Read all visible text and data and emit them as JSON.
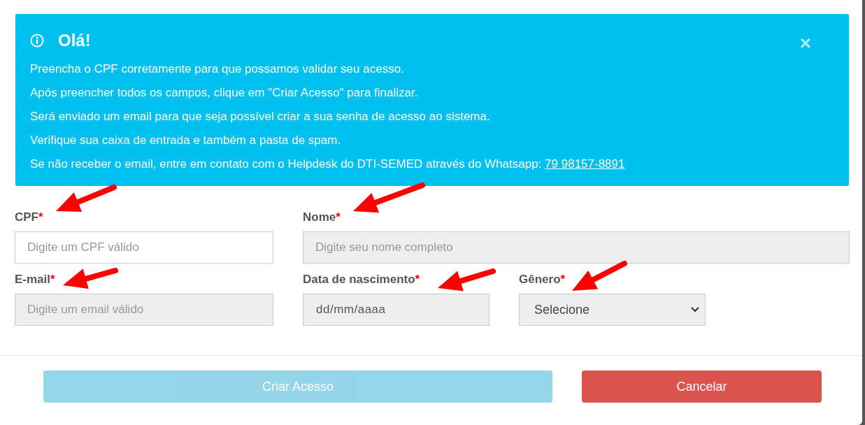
{
  "alert": {
    "title": "Olá!",
    "close": "×",
    "lines": [
      {
        "text": "Preencha o CPF corretamente para que possamos validar seu acesso."
      },
      {
        "text": "Após preencher todos os campos, clique em \"Criar Acesso\" para finalizar."
      },
      {
        "text": "Será enviado um email para que seja possível criar a sua senha de acesso ao sistema."
      },
      {
        "text": "Verifique sua caixa de entrada e também a pasta de spam."
      },
      {
        "text": "Se não receber o email, entre em contato com o Helpdesk do DTI-SEMED através do Whatsapp:",
        "link": "79 98157-8891"
      }
    ]
  },
  "fields": [
    {
      "label": "CPF",
      "required": true,
      "kind": "text",
      "placeholder": "Digite um CPF válido",
      "disabled": false
    },
    {
      "label": "Nome",
      "required": true,
      "kind": "text",
      "placeholder": "Digite seu nome completo",
      "disabled": true
    },
    {
      "label": "E-mail",
      "required": true,
      "kind": "text",
      "placeholder": "Digite um email válido",
      "disabled": true
    },
    {
      "label": "Data de nascimento",
      "required": true,
      "kind": "date",
      "value": "dd/mm/aaaa",
      "disabled": true
    },
    {
      "label": "Gênero",
      "required": true,
      "kind": "select",
      "value": "Selecione",
      "disabled": true
    }
  ],
  "buttons": [
    {
      "label": "Criar Acesso",
      "kind": "primary",
      "disabled": true
    },
    {
      "label": "Cancelar",
      "kind": "danger",
      "disabled": false
    }
  ],
  "required_mark": "*"
}
